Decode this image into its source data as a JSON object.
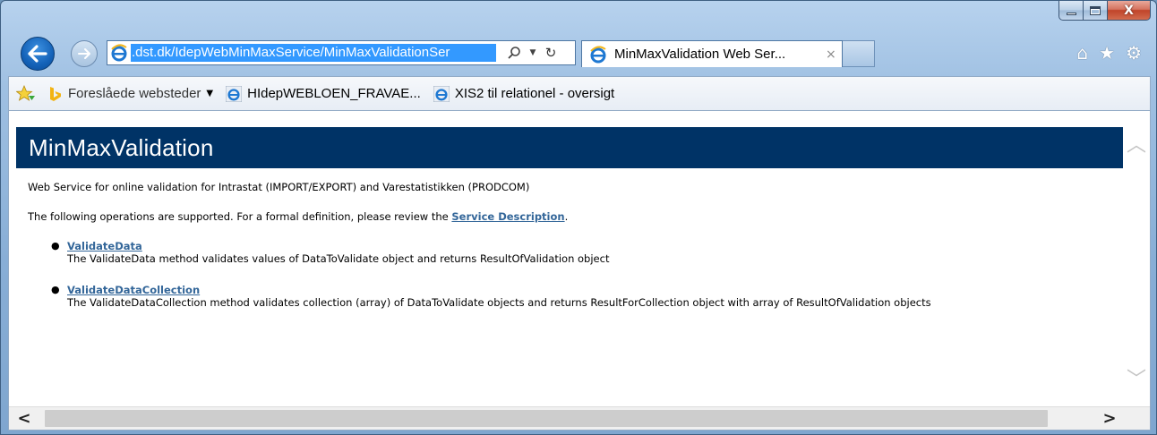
{
  "window": {
    "close_symbol": "X"
  },
  "nav": {
    "address_url": ".dst.dk/IdepWebMinMaxService/MinMaxValidationSer",
    "tab_title": "MinMaxValidation Web Ser...",
    "tab_close": "×"
  },
  "favorites": {
    "suggested_label": "Foreslåede websteder",
    "items": [
      {
        "label": "HIdepWEBLOEN_FRAVAE..."
      },
      {
        "label": "XIS2 til relationel - oversigt"
      }
    ]
  },
  "page": {
    "title": "MinMaxValidation",
    "intro": "Web Service for online validation for Intrastat (IMPORT/EXPORT) and Varestatistikken (PRODCOM)",
    "ops_sentence_prefix": "The following operations are supported. For a formal definition, please review the ",
    "service_description_link": "Service Description",
    "ops_sentence_suffix": ".",
    "operations": [
      {
        "name": "ValidateData",
        "description": "The ValidateData method validates values of DataToValidate object and returns ResultOfValidation object"
      },
      {
        "name": "ValidateDataCollection",
        "description": "The ValidateDataCollection method validates collection (array) of DataToValidate objects and returns ResultForCollection object with array of ResultOfValidation objects"
      }
    ]
  },
  "colors": {
    "header_bg": "#003366",
    "link": "#336699",
    "address_highlight": "#3399ff"
  }
}
